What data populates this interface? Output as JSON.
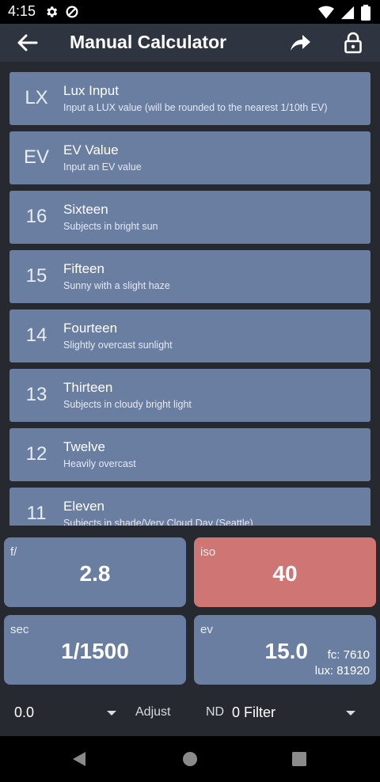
{
  "status_bar": {
    "time": "4:15"
  },
  "app_bar": {
    "title": "Manual Calculator"
  },
  "list": [
    {
      "icon": "LX",
      "title": "Lux Input",
      "subtitle": "Input a LUX value (will be rounded to the nearest 1/10th EV)"
    },
    {
      "icon": "EV",
      "title": "EV Value",
      "subtitle": "Input an EV value"
    },
    {
      "icon": "16",
      "title": "Sixteen",
      "subtitle": "Subjects in bright sun"
    },
    {
      "icon": "15",
      "title": "Fifteen",
      "subtitle": "Sunny with a slight haze"
    },
    {
      "icon": "14",
      "title": "Fourteen",
      "subtitle": "Slightly overcast sunlight"
    },
    {
      "icon": "13",
      "title": "Thirteen",
      "subtitle": "Subjects in cloudy bright light"
    },
    {
      "icon": "12",
      "title": "Twelve",
      "subtitle": "Heavily overcast"
    },
    {
      "icon": "11",
      "title": "Eleven",
      "subtitle": "Subjects in shade/Very Cloud Day (Seattle)"
    }
  ],
  "tiles": {
    "aperture": {
      "label": "f/",
      "value": "2.8"
    },
    "iso": {
      "label": "iso",
      "value": "40"
    },
    "shutter": {
      "label": "sec",
      "value": "1/1500"
    },
    "ev": {
      "label": "ev",
      "value": "15.0",
      "fc": "fc: 7610",
      "lux": "lux: 81920"
    }
  },
  "bottom": {
    "adjust_value": "0.0",
    "adjust_label": "Adjust",
    "nd_label": "ND",
    "filter_value": "0 Filter"
  },
  "colors": {
    "tile": "#6a7ea2",
    "iso_tile": "#cf7574",
    "app_bar": "#2e3440",
    "background": "#262a30"
  }
}
